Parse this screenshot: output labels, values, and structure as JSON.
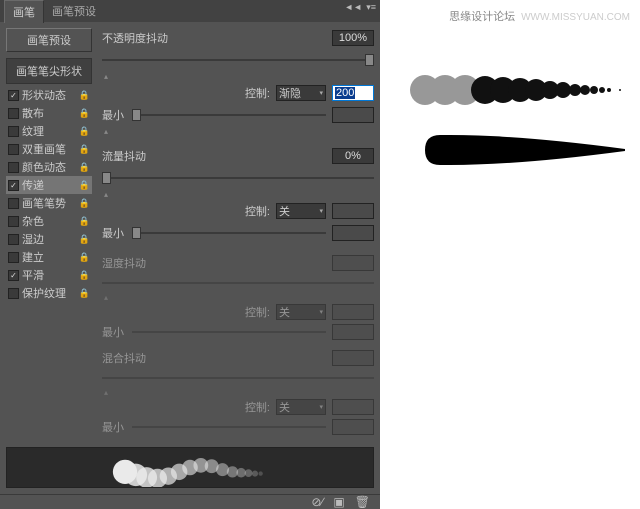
{
  "tabs": {
    "active": "画笔",
    "inactive": "画笔预设"
  },
  "preset_button": "画笔预设",
  "tip_header": "画笔笔尖形状",
  "options": [
    {
      "label": "形状动态",
      "checked": true,
      "selected": false
    },
    {
      "label": "散布",
      "checked": false,
      "selected": false
    },
    {
      "label": "纹理",
      "checked": false,
      "selected": false
    },
    {
      "label": "双重画笔",
      "checked": false,
      "selected": false
    },
    {
      "label": "颜色动态",
      "checked": false,
      "selected": false
    },
    {
      "label": "传递",
      "checked": true,
      "selected": true
    },
    {
      "label": "画笔笔势",
      "checked": false,
      "selected": false
    },
    {
      "label": "杂色",
      "checked": false,
      "selected": false
    },
    {
      "label": "湿边",
      "checked": false,
      "selected": false
    },
    {
      "label": "建立",
      "checked": false,
      "selected": false
    },
    {
      "label": "平滑",
      "checked": true,
      "selected": false
    },
    {
      "label": "保护纹理",
      "checked": false,
      "selected": false
    }
  ],
  "opacity_jitter": {
    "label": "不透明度抖动",
    "value": "100%"
  },
  "opacity_control": {
    "label": "控制:",
    "select": "渐隐",
    "value": "200"
  },
  "opacity_min": {
    "label": "最小",
    "value": ""
  },
  "flow_jitter": {
    "label": "流量抖动",
    "value": "0%"
  },
  "flow_control": {
    "label": "控制:",
    "select": "关"
  },
  "flow_min": {
    "label": "最小"
  },
  "wetness_jitter": {
    "label": "湿度抖动"
  },
  "wetness_control": {
    "label": "控制:",
    "select": "关"
  },
  "wetness_min": {
    "label": "最小"
  },
  "mix_jitter": {
    "label": "混合抖动"
  },
  "mix_control": {
    "label": "控制:",
    "select": "关"
  },
  "mix_min": {
    "label": "最小"
  },
  "watermark": {
    "text": "思缘设计论坛",
    "site": "WWW.MISSYUAN.COM"
  }
}
